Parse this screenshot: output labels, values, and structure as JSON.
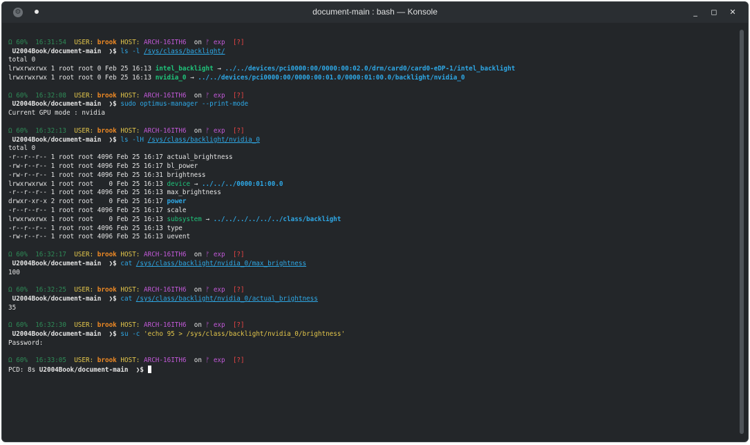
{
  "window": {
    "title": "document-main : bash — Konsole",
    "app_icon": "konsole-icon",
    "pin_icon": "pin-icon",
    "minimize": "_",
    "maximize": "◻",
    "close": "✕"
  },
  "prompts": [
    {
      "bat": "Ω 60%",
      "time": "16:31:54",
      "user_label": "USER:",
      "user": "brook",
      "host_label": "HOST:",
      "host": "ARCH-16ITH6",
      "on": "on",
      "branch_icon": "ᚠ",
      "branch": "exp",
      "status": "[?]",
      "cwd": "U2004Book/document-main",
      "sym": "❯$",
      "cmd": "ls",
      "args": "-l",
      "path": "/sys/class/backlight/"
    },
    {
      "bat": "Ω 60%",
      "time": "16:32:08",
      "user_label": "USER:",
      "user": "brook",
      "host_label": "HOST:",
      "host": "ARCH-16ITH6",
      "on": "on",
      "branch_icon": "ᚠ",
      "branch": "exp",
      "status": "[?]",
      "cwd": "U2004Book/document-main",
      "sym": "❯$",
      "cmd": "sudo",
      "args": "optimus-manager --print-mode",
      "path": ""
    },
    {
      "bat": "Ω 60%",
      "time": "16:32:13",
      "user_label": "USER:",
      "user": "brook",
      "host_label": "HOST:",
      "host": "ARCH-16ITH6",
      "on": "on",
      "branch_icon": "ᚠ",
      "branch": "exp",
      "status": "[?]",
      "cwd": "U2004Book/document-main",
      "sym": "❯$",
      "cmd": "ls",
      "args": "-lH",
      "path": "/sys/class/backlight/nvidia_0"
    },
    {
      "bat": "Ω 60%",
      "time": "16:32:17",
      "user_label": "USER:",
      "user": "brook",
      "host_label": "HOST:",
      "host": "ARCH-16ITH6",
      "on": "on",
      "branch_icon": "ᚠ",
      "branch": "exp",
      "status": "[?]",
      "cwd": "U2004Book/document-main",
      "sym": "❯$",
      "cmd": "cat",
      "args": "",
      "path": "/sys/class/backlight/nvidia_0/max_brightness"
    },
    {
      "bat": "Ω 60%",
      "time": "16:32:25",
      "user_label": "USER:",
      "user": "brook",
      "host_label": "HOST:",
      "host": "ARCH-16ITH6",
      "on": "on",
      "branch_icon": "ᚠ",
      "branch": "exp",
      "status": "[?]",
      "cwd": "U2004Book/document-main",
      "sym": "❯$",
      "cmd": "cat",
      "args": "",
      "path": "/sys/class/backlight/nvidia_0/actual_brightness"
    },
    {
      "bat": "Ω 60%",
      "time": "16:32:30",
      "user_label": "USER:",
      "user": "brook",
      "host_label": "HOST:",
      "host": "ARCH-16ITH6",
      "on": "on",
      "branch_icon": "ᚠ",
      "branch": "exp",
      "status": "[?]",
      "cwd": "U2004Book/document-main",
      "sym": "❯$",
      "cmd": "su",
      "args": "-c",
      "path": "'echo 95 > /sys/class/backlight/nvidia_0/brightness'"
    },
    {
      "bat": "Ω 60%",
      "time": "16:33:05",
      "user_label": "USER:",
      "user": "brook",
      "host_label": "HOST:",
      "host": "ARCH-16ITH6",
      "on": "on",
      "branch_icon": "ᚠ",
      "branch": "exp",
      "status": "[?]",
      "cwd": "",
      "sym": "",
      "cmd": "",
      "args": "",
      "path": ""
    }
  ],
  "out1": {
    "total": "total 0",
    "rows": [
      {
        "perm": "lrwxrwxrwx 1 root root 0 Feb 25 16:13 ",
        "name": "intel_backlight",
        "arrow": " → ",
        "target": "../../devices/pci0000:00/0000:00:02.0/drm/card0/card0-eDP-1/intel_backlight"
      },
      {
        "perm": "lrwxrwxrwx 1 root root 0 Feb 25 16:13 ",
        "name": "nvidia_0",
        "arrow": " → ",
        "target": "../../devices/pci0000:00/0000:00:01.0/0000:01:00.0/backlight/nvidia_0"
      }
    ]
  },
  "out2": "Current GPU mode : nvidia",
  "out3": {
    "total": "total 0",
    "rows": [
      {
        "perm": "-r--r--r-- 1 root root 4096 Feb 25 16:17 ",
        "name": "actual_brightness",
        "kind": "file",
        "arrow": "",
        "target": ""
      },
      {
        "perm": "-rw-r--r-- 1 root root 4096 Feb 25 16:17 ",
        "name": "bl_power",
        "kind": "file",
        "arrow": "",
        "target": ""
      },
      {
        "perm": "-rw-r--r-- 1 root root 4096 Feb 25 16:31 ",
        "name": "brightness",
        "kind": "file",
        "arrow": "",
        "target": ""
      },
      {
        "perm": "lrwxrwxrwx 1 root root    0 Feb 25 16:13 ",
        "name": "device",
        "kind": "link",
        "arrow": " → ",
        "target": "../../../0000:01:00.0"
      },
      {
        "perm": "-r--r--r-- 1 root root 4096 Feb 25 16:13 ",
        "name": "max_brightness",
        "kind": "file",
        "arrow": "",
        "target": ""
      },
      {
        "perm": "drwxr-xr-x 2 root root    0 Feb 25 16:17 ",
        "name": "power",
        "kind": "dir",
        "arrow": "",
        "target": ""
      },
      {
        "perm": "-r--r--r-- 1 root root 4096 Feb 25 16:17 ",
        "name": "scale",
        "kind": "file",
        "arrow": "",
        "target": ""
      },
      {
        "perm": "lrwxrwxrwx 1 root root    0 Feb 25 16:13 ",
        "name": "subsystem",
        "kind": "link",
        "arrow": " → ",
        "target": "../../../../../../class/backlight"
      },
      {
        "perm": "-r--r--r-- 1 root root 4096 Feb 25 16:13 ",
        "name": "type",
        "kind": "file",
        "arrow": "",
        "target": ""
      },
      {
        "perm": "-rw-r--r-- 1 root root 4096 Feb 25 16:13 ",
        "name": "uevent",
        "kind": "file",
        "arrow": "",
        "target": ""
      }
    ]
  },
  "out4": "100",
  "out5": "35",
  "out6": "Password:",
  "last_prompt": {
    "prefix": "PCD: 8s ",
    "cwd": "U2004Book/document-main",
    "sym": "❯$"
  }
}
